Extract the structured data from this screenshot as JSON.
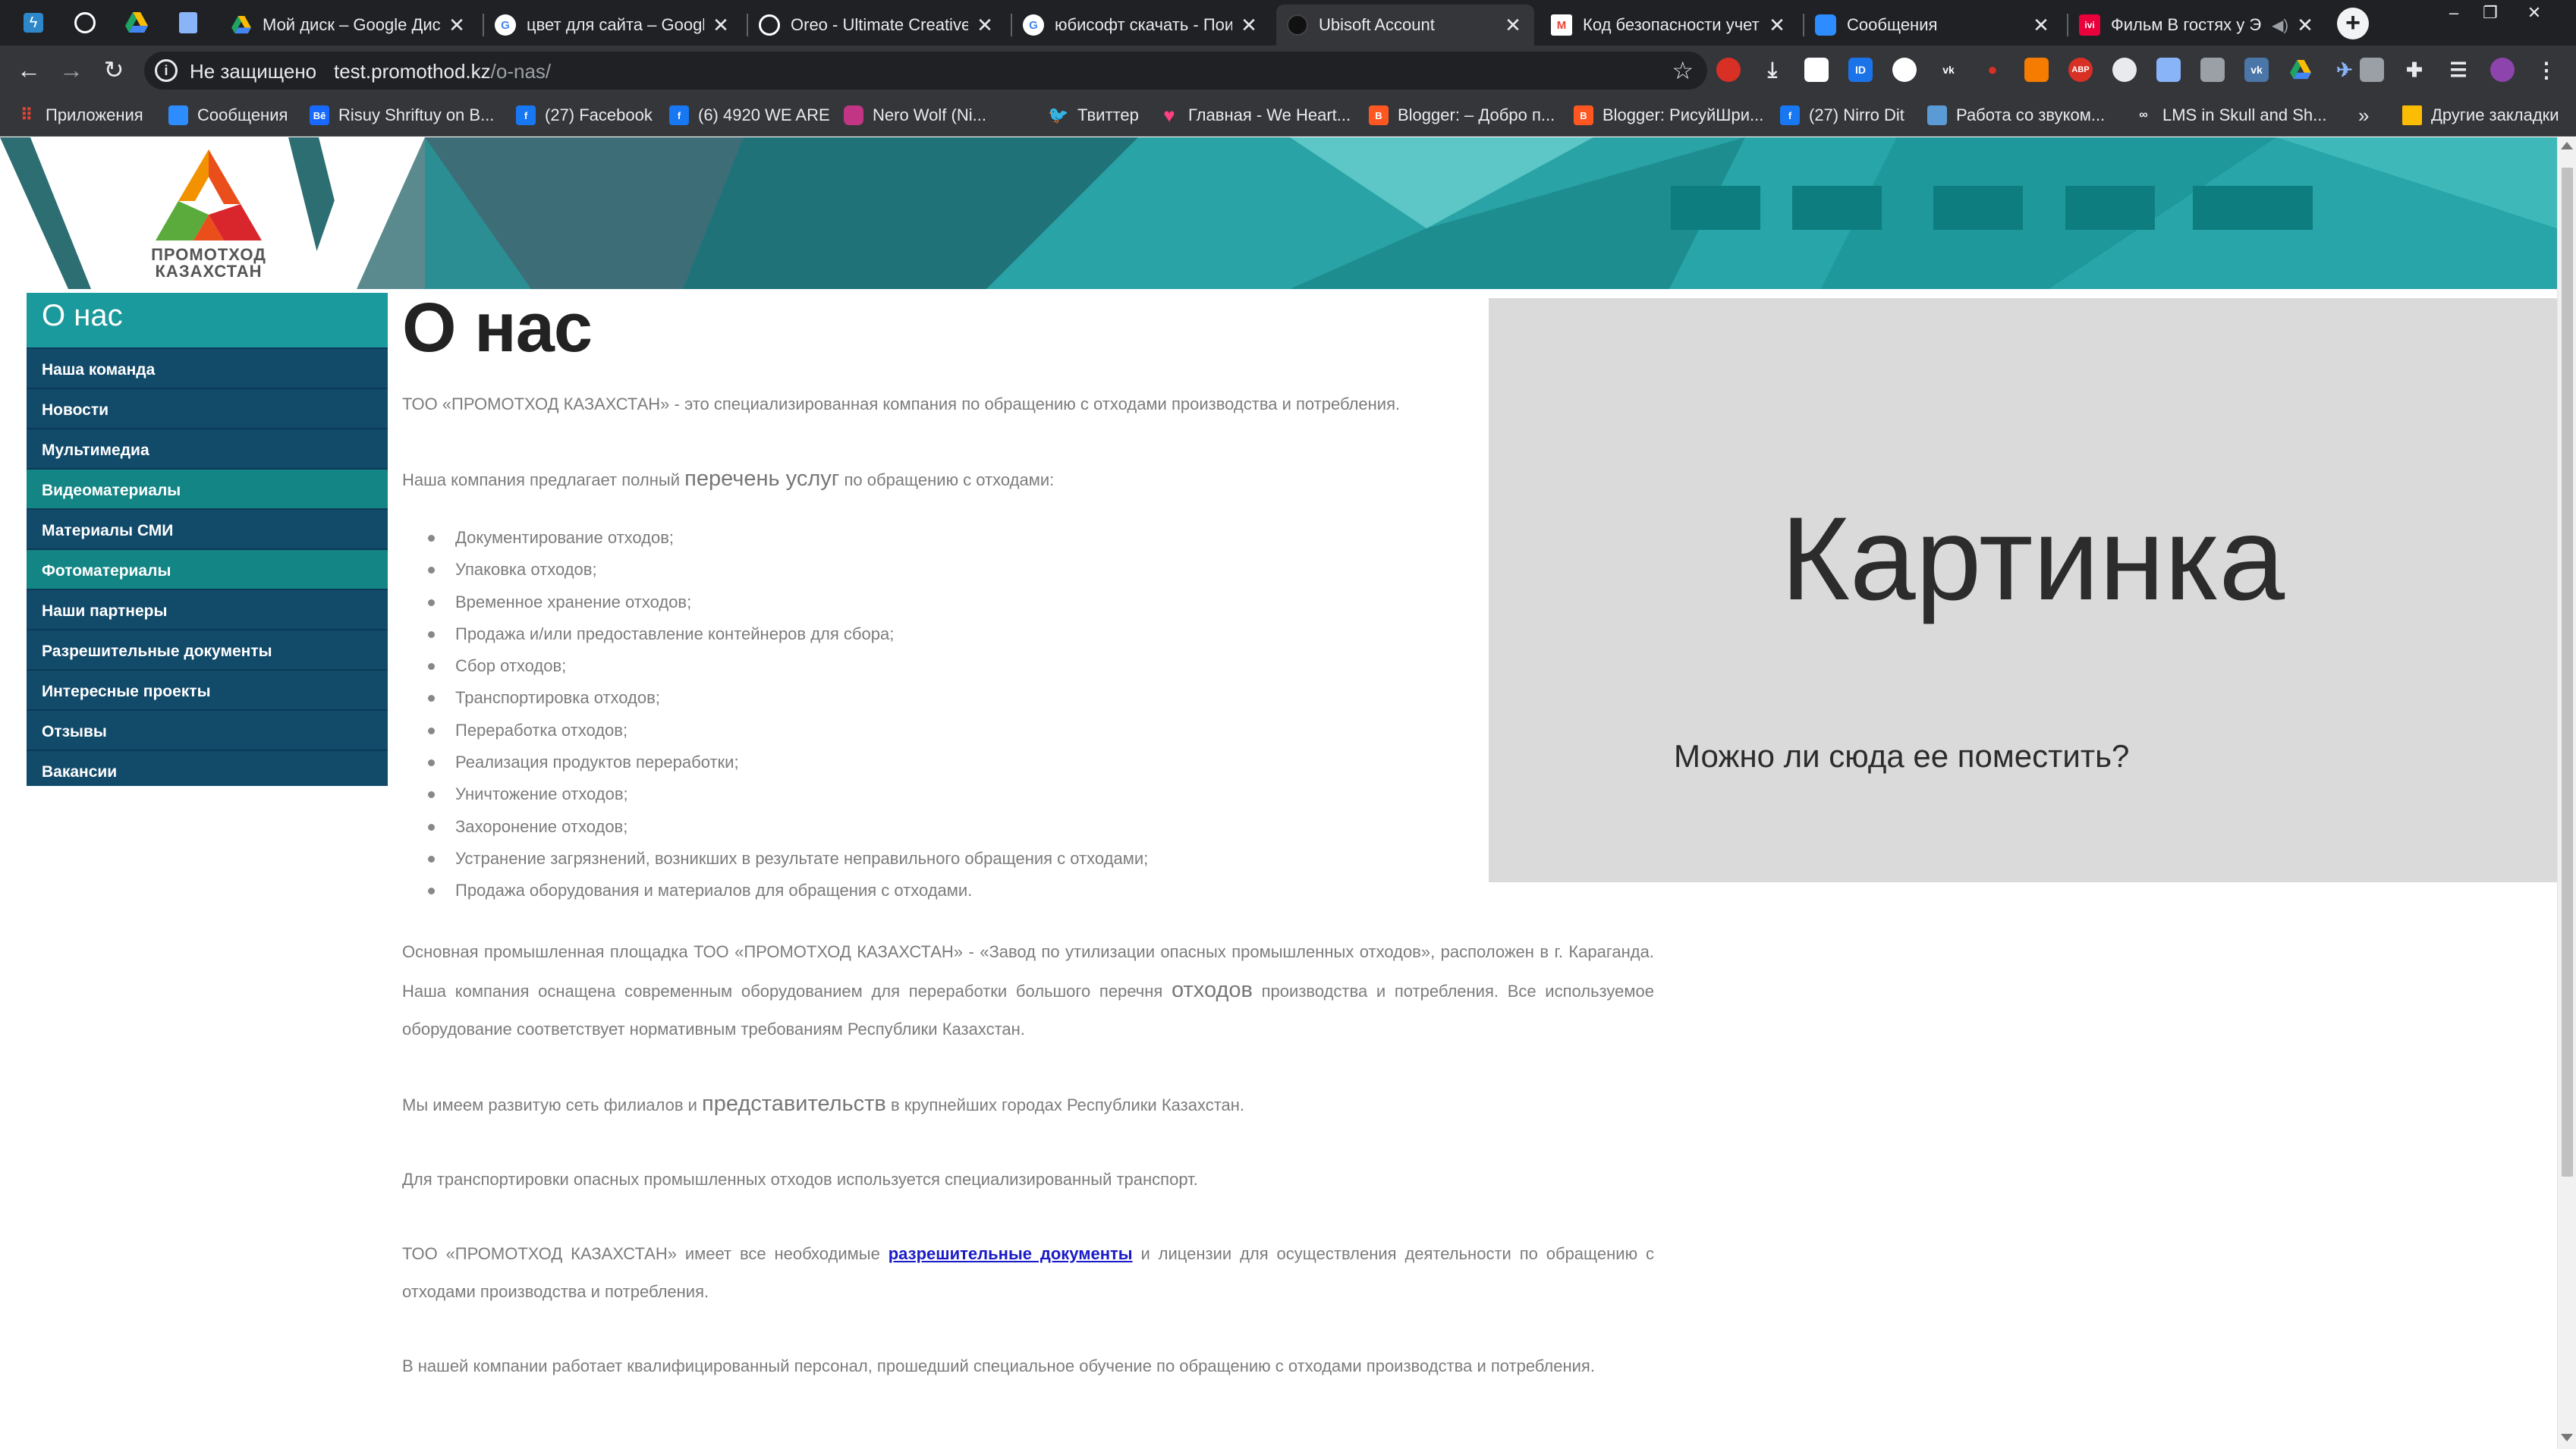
{
  "browser": {
    "tabs": [
      {
        "title": "Мой диск – Google Диск",
        "icon": "google-drive-icon",
        "color": "#1fa463"
      },
      {
        "title": "цвет для сайта – Google",
        "icon": "google-icon",
        "color": "#ffffff"
      },
      {
        "title": "Oreo - Ultimate Creative",
        "icon": "globe-icon",
        "color": "#ffffff"
      },
      {
        "title": "юбисофт скачать - Пои",
        "icon": "google-icon",
        "color": "#ffffff"
      },
      {
        "title": "Ubisoft Account",
        "icon": "ubisoft-icon",
        "color": "#111111"
      },
      {
        "title": "Код безопасности учет",
        "icon": "gmail-icon",
        "color": "#ea4335"
      },
      {
        "title": "Сообщения",
        "icon": "messages-icon",
        "color": "#2d8cff"
      },
      {
        "title": "Фильм В гостях у Э",
        "icon": "ivi-icon",
        "color": "#ea003d"
      }
    ],
    "active_tab": 4,
    "omnibox": {
      "security": "Не защищено",
      "host": "test.promothod.kz",
      "path": "/o-nas/"
    },
    "bookmarks": [
      {
        "label": "Приложения",
        "icon": "apps-grid-icon",
        "color": "#4285f4"
      },
      {
        "label": "Сообщения",
        "icon": "messages-icon",
        "color": "#2d8cff"
      },
      {
        "label": "Risuy Shriftuy on B...",
        "icon": "behance-icon",
        "color": "#1769ff"
      },
      {
        "label": "(27) Facebook",
        "icon": "facebook-icon",
        "color": "#1877f2"
      },
      {
        "label": "(6) 4920 WE ARE",
        "icon": "facebook-icon",
        "color": "#1877f2"
      },
      {
        "label": "Nero Wolf (Ni...",
        "icon": "instagram-icon",
        "color": "#c13584"
      },
      {
        "label": "Твиттер",
        "icon": "twitter-icon",
        "color": "#1da1f2"
      },
      {
        "label": "Главная - We Heart...",
        "icon": "heart-icon",
        "color": "#ff3f7f"
      },
      {
        "label": "Blogger: – Добро п...",
        "icon": "blogger-icon",
        "color": "#ff5722"
      },
      {
        "label": "Blogger: РисуйШри...",
        "icon": "blogger-icon",
        "color": "#ff5722"
      },
      {
        "label": "(27) Nirro Dit",
        "icon": "facebook-icon",
        "color": "#1877f2"
      },
      {
        "label": "Работа со звуком...",
        "icon": "bookmark-page-icon",
        "color": "#5b9bd5"
      },
      {
        "label": "LMS in Skull and Sh...",
        "icon": "link-icon",
        "color": "#9aa0a6"
      }
    ],
    "bookmarks_more": "»",
    "other_bookmarks": "Другие закладки"
  },
  "site": {
    "logo": {
      "line1": "ПРОМОТХОД",
      "line2": "КАЗАХСТАН"
    },
    "sidebar": {
      "title": "О нас",
      "items": [
        {
          "label": "Наша команда",
          "teal": false
        },
        {
          "label": "Новости",
          "teal": false
        },
        {
          "label": "Мультимедиа",
          "teal": false
        },
        {
          "label": "Видеоматериалы",
          "teal": true
        },
        {
          "label": "Материалы СМИ",
          "teal": false
        },
        {
          "label": "Фотоматериалы",
          "teal": true
        },
        {
          "label": "Наши партнеры",
          "teal": false
        },
        {
          "label": "Разрешительные документы",
          "teal": false
        },
        {
          "label": "Интересные проекты",
          "teal": false
        },
        {
          "label": "Отзывы",
          "teal": false
        },
        {
          "label": "Вакансии",
          "teal": false
        }
      ]
    },
    "content": {
      "title": "О нас",
      "intro": "ТОО «ПРОМОТХОД КАЗАХСТАН» - это специализированная компания по обращению с отходами производства и потребления.",
      "offer_before": "Наша компания предлагает полный",
      "offer_big": "перечень услуг",
      "offer_after": "по обращению с отходами:",
      "services": [
        "Документирование отходов;",
        "Упаковка отходов;",
        "Временное хранение отходов;",
        "Продажа и/или предоставление контейнеров для сбора;",
        "Сбор отходов;",
        "Транспортировка отходов;",
        "Переработка отходов;",
        "Реализация продуктов переработки;",
        "Уничтожение отходов;",
        "Захоронение отходов;",
        "Устранение загрязнений, возникших в результате неправильного обращения с отходами;",
        "Продажа оборудования и материалов для обращения с отходами."
      ],
      "plant_1": "Основная промышленная площадка ТОО «ПРОМОТХОД КАЗАХСТАН» - «Завод по утилизации опасных промышленных отходов», расположен в г. Караганда. Наша компания оснащена современным оборудованием для переработки большого перечня",
      "plant_big": "отходов",
      "plant_2": "производства и потребления. Все используемое оборудование соответствует нормативным требованиям Республики Казахстан.",
      "branches_before": "Мы имеем развитую сеть филиалов и",
      "branches_big": "представительств",
      "branches_after": "в крупнейших городах Республики Казахстан.",
      "transport": "Для транспортировки опасных промышленных отходов используется специализированный транспорт.",
      "permits_before": "ТОО «ПРОМОТХОД КАЗАХСТАН» имеет все необходимые",
      "permits_link": "разрешительные документы",
      "permits_after": "и лицензии для осуществления деятельности по обращению с отходами производства и потребления.",
      "staff": "В нашей компании работает квалифицированный персонал, прошедший специальное обучение по обращению с отходами производства и потребления."
    },
    "picture": {
      "title": "Картинка",
      "question": "Можно ли сюда ее поместить?"
    }
  },
  "colors": {
    "sidebar_bg": "#124a6a",
    "sidebar_teal": "#138585",
    "sidebar_header": "#1a9a9c",
    "banner_teal": "#2a9c9e",
    "placeholder_bg": "#d9dad9"
  }
}
